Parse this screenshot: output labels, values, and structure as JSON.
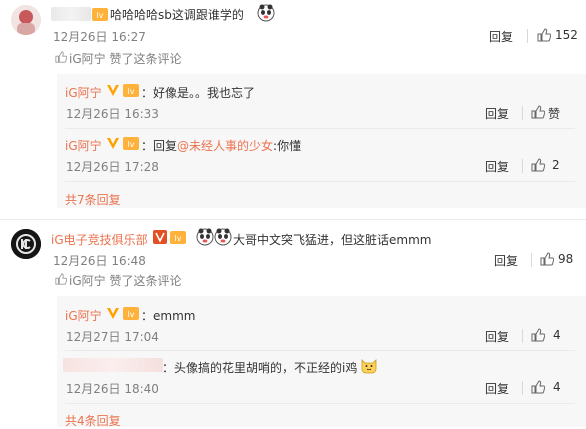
{
  "comments": [
    {
      "text": "哈哈哈哈sb这调跟谁学的",
      "time": "12月26日 16:27",
      "reply_label": "回复",
      "like_count": "152",
      "liked_by": "iG阿宁 赞了这条评论",
      "replies": [
        {
          "author": "iG阿宁",
          "text": "：好像是。。我也忘了",
          "time": "12月26日 16:33",
          "reply_label": "回复",
          "like_label": "赞"
        },
        {
          "author": "iG阿宁",
          "text_prefix": "：回复",
          "mention": "@未经人事的少女",
          "text_suffix": ":你懂",
          "time": "12月26日 17:28",
          "reply_label": "回复",
          "like_count": "2"
        }
      ],
      "more_replies": "共7条回复"
    },
    {
      "author": "iG电子竞技俱乐部",
      "text": "大哥中文突飞猛进，但这脏话emmm",
      "time": "12月26日 16:48",
      "reply_label": "回复",
      "like_count": "98",
      "liked_by": "iG阿宁 赞了这条评论",
      "replies": [
        {
          "author": "iG阿宁",
          "text": "：emmm",
          "time": "12月27日 17:04",
          "reply_label": "回复",
          "like_count": "4"
        },
        {
          "text": "：头像搞的花里胡哨的，不正经的i鸡",
          "time": "12月26日 18:40",
          "reply_label": "回复",
          "like_count": "4"
        }
      ],
      "more_replies": "共4条回复"
    }
  ],
  "colors": {
    "link": "#eb7350",
    "muted": "#808080",
    "text": "#333333",
    "subbg": "#f7f7f7"
  },
  "icons": [
    "verified-v-icon",
    "level-badge-icon",
    "thumb-up-icon",
    "cat-emoji-icon",
    "panda-emoji-icon",
    "ig-logo-icon"
  ]
}
